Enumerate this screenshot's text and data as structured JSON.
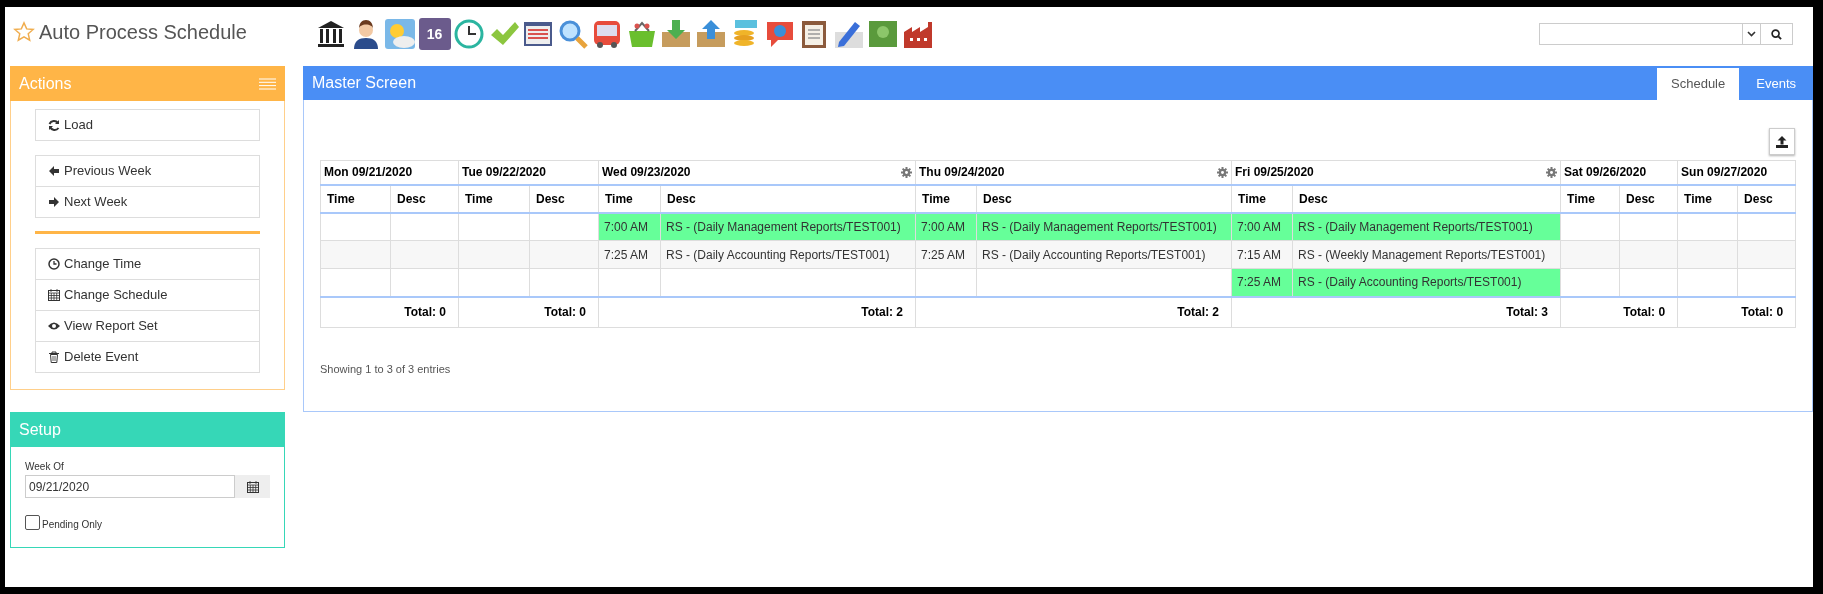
{
  "app": {
    "title": "Auto Process Schedule"
  },
  "toolbar": [
    {
      "kind": "bank"
    },
    {
      "kind": "person"
    },
    {
      "kind": "weather"
    },
    {
      "kind": "calendar",
      "label": "16"
    },
    {
      "kind": "clock"
    },
    {
      "kind": "check"
    },
    {
      "kind": "window"
    },
    {
      "kind": "magnifier"
    },
    {
      "kind": "bus"
    },
    {
      "kind": "basket"
    },
    {
      "kind": "download"
    },
    {
      "kind": "upload"
    },
    {
      "kind": "coins"
    },
    {
      "kind": "bubble"
    },
    {
      "kind": "clipboard"
    },
    {
      "kind": "pencil"
    },
    {
      "kind": "banknote"
    },
    {
      "kind": "factory"
    }
  ],
  "actions": {
    "title": "Actions",
    "groups": [
      [
        {
          "label": "Load"
        }
      ],
      [
        {
          "label": "Previous Week"
        },
        {
          "label": "Next Week"
        }
      ],
      [
        {
          "label": "Change Time"
        },
        {
          "label": "Change Schedule"
        },
        {
          "label": "View Report Set"
        },
        {
          "label": "Delete Event"
        }
      ]
    ]
  },
  "setup": {
    "title": "Setup",
    "week_of": {
      "label": "Week Of",
      "value": "09/21/2020"
    },
    "pending_only": {
      "label": "Pending Only",
      "checked": false
    }
  },
  "master": {
    "title": "Master Screen",
    "tabs": [
      {
        "label": "Schedule",
        "selected": true
      },
      {
        "label": "Events",
        "selected": false
      }
    ],
    "days": [
      {
        "label": "Mon 09/21/2020",
        "settings": false,
        "time_header": "Time",
        "desc_header": "Desc",
        "total": "Total: 0"
      },
      {
        "label": "Tue 09/22/2020",
        "settings": false,
        "time_header": "Time",
        "desc_header": "Desc",
        "total": "Total: 0"
      },
      {
        "label": "Wed 09/23/2020",
        "settings": true,
        "time_header": "Time",
        "desc_header": "Desc",
        "total": "Total: 2"
      },
      {
        "label": "Thu 09/24/2020",
        "settings": true,
        "time_header": "Time",
        "desc_header": "Desc",
        "total": "Total: 2"
      },
      {
        "label": "Fri 09/25/2020",
        "settings": true,
        "time_header": "Time",
        "desc_header": "Desc",
        "total": "Total: 3"
      },
      {
        "label": "Sat 09/26/2020",
        "settings": false,
        "time_header": "Time",
        "desc_header": "Desc",
        "total": "Total: 0"
      },
      {
        "label": "Sun 09/27/2020",
        "settings": false,
        "time_header": "Time",
        "desc_header": "Desc",
        "total": "Total: 0"
      }
    ],
    "rows": [
      {
        "cells": [
          null,
          null,
          {
            "time": "7:00 AM",
            "desc": "RS - (Daily Management Reports/TEST001)",
            "highlighted": true
          },
          {
            "time": "7:00 AM",
            "desc": "RS - (Daily Management Reports/TEST001)",
            "highlighted": true
          },
          {
            "time": "7:00 AM",
            "desc": "RS - (Daily Management Reports/TEST001)",
            "highlighted": true
          },
          null,
          null
        ]
      },
      {
        "cells": [
          null,
          null,
          {
            "time": "7:25 AM",
            "desc": "RS - (Daily Accounting Reports/TEST001)",
            "highlighted": false
          },
          {
            "time": "7:25 AM",
            "desc": "RS - (Daily Accounting Reports/TEST001)",
            "highlighted": false
          },
          {
            "time": "7:15 AM",
            "desc": "RS - (Weekly Management Reports/TEST001)",
            "highlighted": false
          },
          null,
          null
        ]
      },
      {
        "cells": [
          null,
          null,
          null,
          null,
          {
            "time": "7:25 AM",
            "desc": "RS - (Daily Accounting Reports/TEST001)",
            "highlighted": true
          },
          null,
          null
        ]
      }
    ],
    "footer": "Showing 1 to 3 of 3 entries"
  }
}
